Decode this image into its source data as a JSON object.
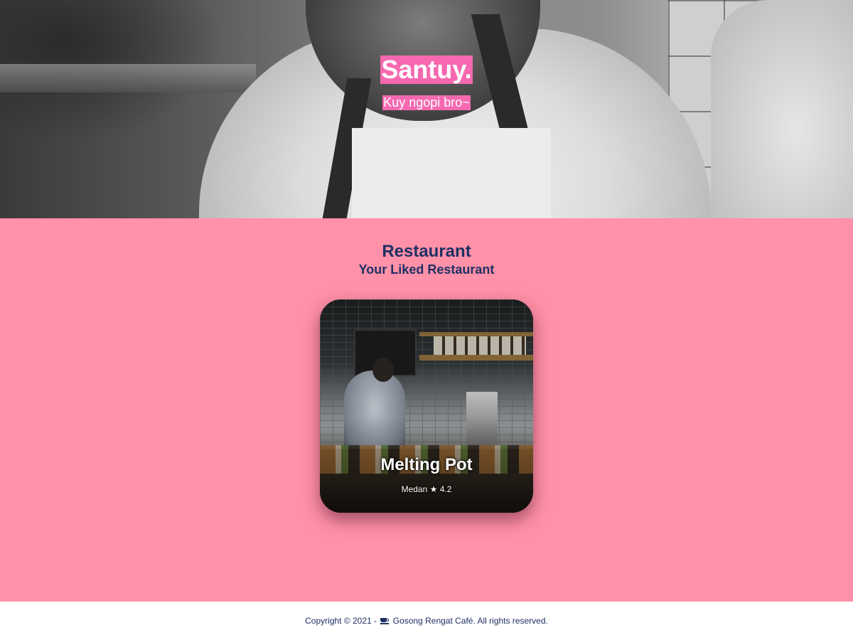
{
  "hero": {
    "title": "Santuy.",
    "subtitle": "Kuy ngopi bro~",
    "image_icon": "chef-photo"
  },
  "main": {
    "heading": "Restaurant",
    "subheading": "Your Liked Restaurant",
    "restaurants": [
      {
        "name": "Melting Pot",
        "city": "Medan",
        "rating": "4.2",
        "rating_icon": "star-icon",
        "image_icon": "restaurant-kitchen-photo"
      }
    ]
  },
  "footer": {
    "copyright_prefix": "Copyright © 2021 -",
    "brand_icon": "coffee-cup-icon",
    "copyright_suffix": "Gosong Rengat Café. All rights reserved."
  },
  "colors": {
    "accent_pink": "#f669b0",
    "section_bg": "#ff91a8",
    "text_navy": "#1f3064",
    "footer_bg": "#ffffff"
  }
}
